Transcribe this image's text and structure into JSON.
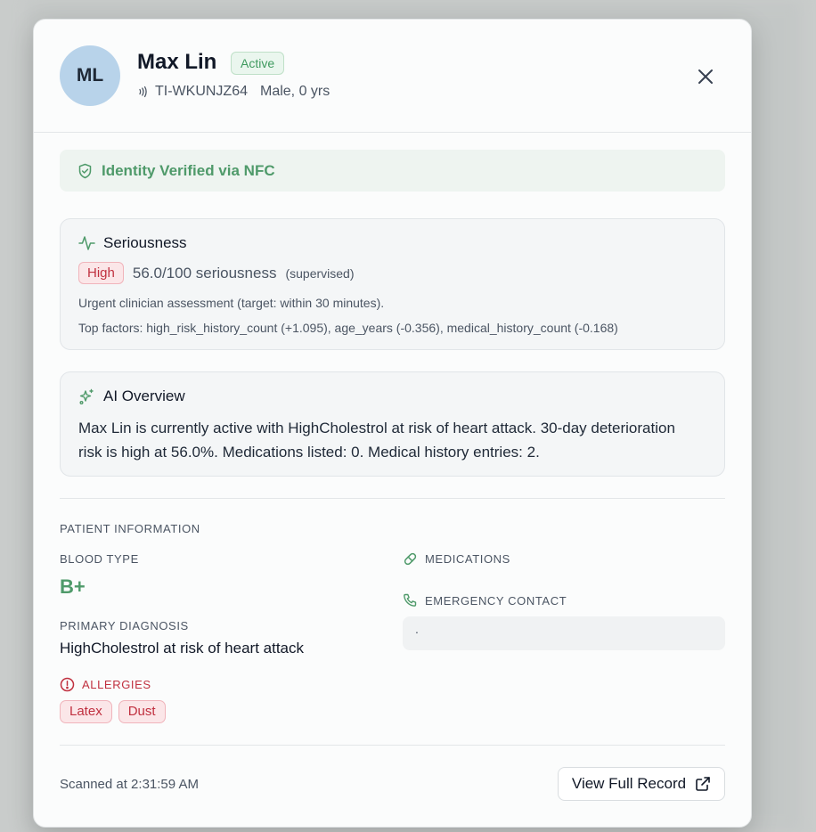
{
  "patient": {
    "initials": "ML",
    "name": "Max Lin",
    "status": "Active",
    "tag_id": "TI-WKUNJZ64",
    "sex_age": "Male, 0 yrs"
  },
  "verification": {
    "text": "Identity Verified via NFC"
  },
  "seriousness": {
    "title": "Seriousness",
    "level": "High",
    "score_text": "56.0/100 seriousness",
    "mode": "(supervised)",
    "note": "Urgent clinician assessment (target: within 30 minutes).",
    "factors": "Top factors: high_risk_history_count (+1.095), age_years (-0.356), medical_history_count (-0.168)"
  },
  "ai_overview": {
    "title": "AI Overview",
    "text": "Max Lin is currently active with HighCholestrol at risk of heart attack. 30-day deterioration risk is high at 56.0%. Medications listed: 0. Medical history entries: 2."
  },
  "patient_info": {
    "section_title": "PATIENT INFORMATION",
    "blood_type_label": "BLOOD TYPE",
    "blood_type": "B+",
    "diagnosis_label": "PRIMARY DIAGNOSIS",
    "diagnosis": "HighCholestrol at risk of heart attack",
    "allergies_label": "ALLERGIES",
    "allergies": [
      "Latex",
      "Dust"
    ],
    "medications_label": "MEDICATIONS",
    "emergency_label": "EMERGENCY CONTACT",
    "emergency_value": "."
  },
  "footer": {
    "scanned": "Scanned at 2:31:59 AM",
    "full_record_label": "View Full Record"
  },
  "colors": {
    "accent_green": "#4f9a6a",
    "danger_red": "#c0303f",
    "avatar_bg": "#b8d3ea"
  },
  "icons": [
    "nfc-icon",
    "close-icon",
    "shield-check-icon",
    "activity-icon",
    "sparkles-icon",
    "alert-circle-icon",
    "pill-icon",
    "phone-icon",
    "external-link-icon"
  ]
}
